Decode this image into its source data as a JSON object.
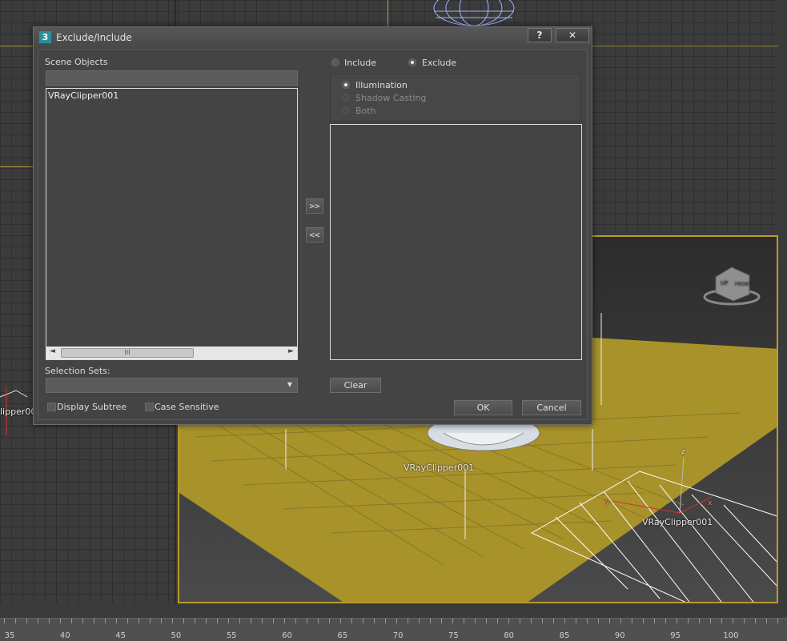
{
  "dialog": {
    "icon_label": "3",
    "title": "Exclude/Include",
    "help_label": "?",
    "close_label": "✕",
    "scene_objects_label": "Scene Objects",
    "scene_filter_value": "",
    "scene_objects": [
      "VRayClipper001"
    ],
    "scroll_grip": "III",
    "scroll_left": "◄",
    "scroll_right": "►",
    "move_right_label": ">>",
    "move_left_label": "<<",
    "mode": {
      "include_label": "Include",
      "exclude_label": "Exclude",
      "selected": "Exclude"
    },
    "exclude_types": {
      "illumination_label": "Illumination",
      "shadow_casting_label": "Shadow Casting",
      "both_label": "Both",
      "selected": "Illumination"
    },
    "selection_sets_label": "Selection Sets:",
    "selection_sets_value": "",
    "dropdown_arrow": "▼",
    "display_subtree_label": "Display Subtree",
    "case_sensitive_label": "Case Sensitive",
    "clear_label": "Clear",
    "ok_label": "OK",
    "cancel_label": "Cancel"
  },
  "viewport": {
    "object_label_main": "VRayClipper001",
    "object_label_clipper": "VRayClipper001",
    "object_label_left": "lipper00",
    "axis_z": "z",
    "axis_y": "y",
    "axis_x": "x",
    "viewcube_up": "UP",
    "viewcube_front": "FRONT"
  },
  "ruler": {
    "numbers": [
      "35",
      "40",
      "45",
      "50",
      "55",
      "60",
      "65",
      "70",
      "75",
      "80",
      "85",
      "90",
      "95",
      "100"
    ]
  },
  "colors": {
    "ground": "#a8922a",
    "dialog_bg": "#444444",
    "viewport_border": "#b89c2a"
  }
}
